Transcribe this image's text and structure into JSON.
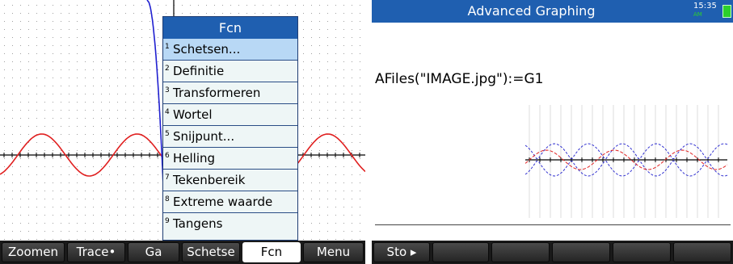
{
  "left": {
    "menu": {
      "title": "Fcn",
      "items": [
        {
          "num": "1",
          "label": "Schetsen..."
        },
        {
          "num": "2",
          "label": "Definitie"
        },
        {
          "num": "3",
          "label": "Transformeren"
        },
        {
          "num": "4",
          "label": "Wortel"
        },
        {
          "num": "5",
          "label": "Snijpunt..."
        },
        {
          "num": "6",
          "label": "Helling"
        },
        {
          "num": "7",
          "label": "Tekenbereik"
        },
        {
          "num": "8",
          "label": "Extreme waarde"
        },
        {
          "num": "9",
          "label": "Tangens"
        }
      ],
      "selected_index": 0
    },
    "softkeys": [
      "Zoomen",
      "Trace•",
      "Ga",
      "Schetse",
      "Fcn",
      "Menu"
    ],
    "active_softkey": "Fcn"
  },
  "right": {
    "title": "Advanced Graphing",
    "clock": "15:35",
    "clock_sub": "AM",
    "command": "AFiles(\"IMAGE.jpg\"):=G1",
    "softkeys": [
      "Sto ▸",
      "",
      "",
      "",
      "",
      ""
    ]
  },
  "colors": {
    "titlebar": "#1f5fb0",
    "curve_red": "#e02020",
    "curve_blue": "#2020d0",
    "menu_selected": "#b8d8f5"
  }
}
